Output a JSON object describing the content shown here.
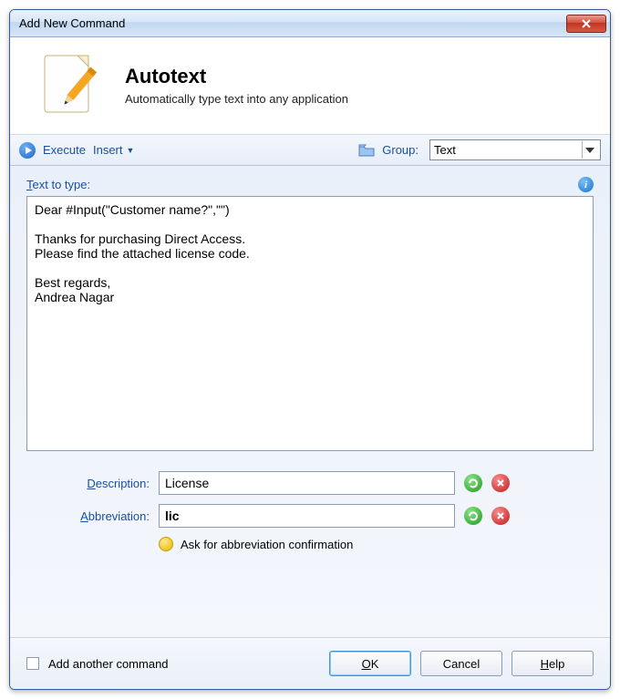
{
  "window": {
    "title": "Add New Command"
  },
  "header": {
    "title": "Autotext",
    "subtitle": "Automatically type text into any application"
  },
  "toolbar": {
    "execute_label": "Execute",
    "insert_label": "Insert",
    "group_label": "Group:",
    "group_value": "Text"
  },
  "text_area": {
    "label": "Text to type:",
    "value": "Dear #Input(\"Customer name?\",\"\")\n\nThanks for purchasing Direct Access.\nPlease find the attached license code.\n\nBest regards,\nAndrea Nagar"
  },
  "fields": {
    "description_label": "escription:",
    "description_value": "License",
    "abbreviation_label": "bbreviation:",
    "abbreviation_value": "lic",
    "confirmation_label": "Ask for abbreviation confirmation"
  },
  "footer": {
    "add_another_label": "Add another command",
    "ok_label": "K",
    "cancel_label": "Cancel",
    "help_label": "elp"
  }
}
